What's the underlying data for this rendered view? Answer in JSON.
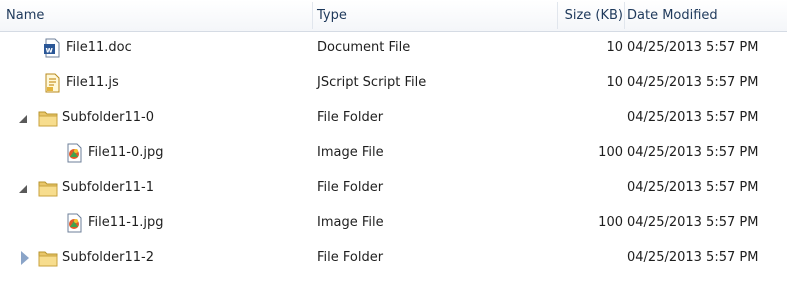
{
  "columns": {
    "name": "Name",
    "type": "Type",
    "size": "Size (KB)",
    "date": "Date Modified"
  },
  "rows": [
    {
      "name": "File11.doc",
      "type": "Document File",
      "size": "10",
      "date": "04/25/2013 5:57 PM",
      "icon": "word-doc-icon",
      "level": 1
    },
    {
      "name": "File11.js",
      "type": "JScript Script File",
      "size": "10",
      "date": "04/25/2013 5:57 PM",
      "icon": "script-file-icon",
      "level": 1
    },
    {
      "name": "Subfolder11-0",
      "type": "File Folder",
      "size": "",
      "date": "04/25/2013 5:57 PM",
      "icon": "folder-icon",
      "level": 1,
      "expander": "expanded"
    },
    {
      "name": "File11-0.jpg",
      "type": "Image File",
      "size": "100",
      "date": "04/25/2013 5:57 PM",
      "icon": "image-file-icon",
      "level": 2
    },
    {
      "name": "Subfolder11-1",
      "type": "File Folder",
      "size": "",
      "date": "04/25/2013 5:57 PM",
      "icon": "folder-icon",
      "level": 1,
      "expander": "expanded"
    },
    {
      "name": "File11-1.jpg",
      "type": "Image File",
      "size": "100",
      "date": "04/25/2013 5:57 PM",
      "icon": "image-file-icon",
      "level": 2
    },
    {
      "name": "Subfolder11-2",
      "type": "File Folder",
      "size": "",
      "date": "04/25/2013 5:57 PM",
      "icon": "folder-icon",
      "level": 1,
      "expander": "collapsed"
    }
  ]
}
